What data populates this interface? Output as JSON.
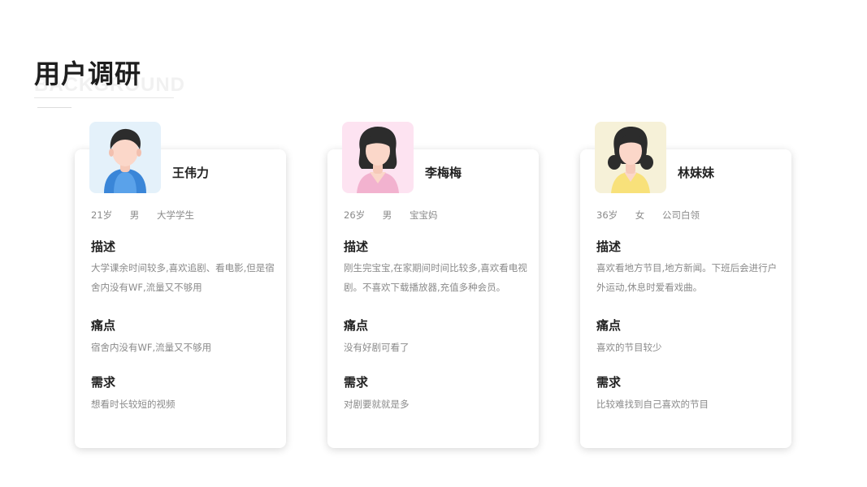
{
  "header": {
    "title": "用户调研",
    "background_word": "BACKGROUND"
  },
  "labels": {
    "description": "描述",
    "pain_points": "痛点",
    "needs": "需求"
  },
  "personas": [
    {
      "name": "王伟力",
      "age": "21岁",
      "gender": "男",
      "occupation": "大学学生",
      "description": "大学课余时间较多,喜欢追剧、看电影,但是宿舍内没有WF,流量又不够用",
      "pain_points": "宿舍内没有WF,流量又不够用",
      "needs": "想看时长较短的视频",
      "avatar_icon": "boy-avatar-icon",
      "avatar_bg": "#e4f1fa"
    },
    {
      "name": "李梅梅",
      "age": "26岁",
      "gender": "男",
      "occupation": "宝宝妈",
      "description": "刚生完宝宝,在家期间时间比较多,喜欢看电视剧。不喜欢下载播放器,充值多种会员。",
      "pain_points": "没有好剧可看了",
      "needs": "对剧要就就是多",
      "avatar_icon": "girl-avatar-icon",
      "avatar_bg": "#fde3f1"
    },
    {
      "name": "林妹妹",
      "age": "36岁",
      "gender": "女",
      "occupation": "公司白领",
      "description": "喜欢看地方节目,地方新闻。下班后会进行户外运动,休息时爱看戏曲。",
      "pain_points": "喜欢的节目较少",
      "needs": "比较难找到自己喜欢的节目",
      "avatar_icon": "woman-avatar-icon",
      "avatar_bg": "#f6f1d8"
    }
  ]
}
